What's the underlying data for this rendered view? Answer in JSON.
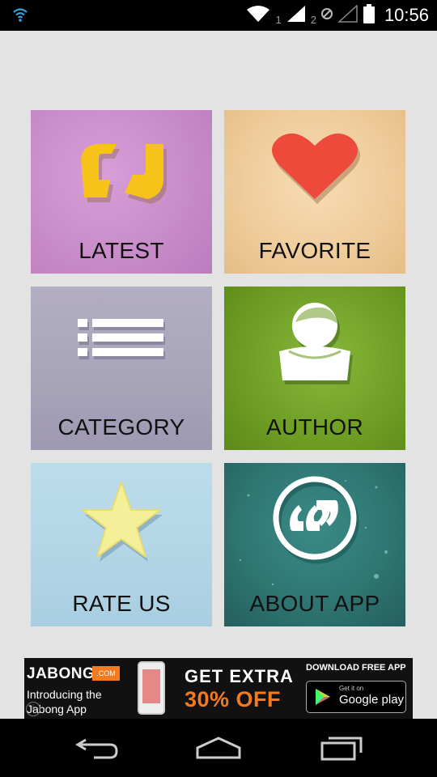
{
  "status_bar": {
    "sim1_label": "1",
    "sim2_label": "2",
    "time": "10:56",
    "icons": [
      "wifi-icon",
      "wifi-signal-icon",
      "cell-signal-1-icon",
      "cell-signal-2-icon",
      "cell-signal-empty-icon",
      "battery-icon"
    ]
  },
  "menu": {
    "latest": {
      "label": "LATEST",
      "icon": "quote-icon"
    },
    "favorite": {
      "label": "FAVORITE",
      "icon": "heart-icon"
    },
    "category": {
      "label": "CATEGORY",
      "icon": "list-icon"
    },
    "author": {
      "label": "AUTHOR",
      "icon": "person-icon"
    },
    "rate_us": {
      "label": "RATE US",
      "icon": "star-icon"
    },
    "about_app": {
      "label": "ABOUT APP",
      "icon": "quote-circle-icon"
    }
  },
  "ad": {
    "brand": "JABONG",
    "brand_tag": ".COM",
    "intro_line1": "Introducing the",
    "intro_line2": "Jabong App",
    "headline": "GET EXTRA",
    "offer": "30% OFF",
    "download_label": "DOWNLOAD FREE APP",
    "store_sub": "Get it on",
    "store_name": "Google play",
    "info_glyph": "i"
  },
  "colors": {
    "latest_bg": "#c98cca",
    "favorite_bg": "#efcd9c",
    "category_bg": "#a7a3b9",
    "author_bg": "#6f9d24",
    "rate_bg": "#b2d5e6",
    "about_bg": "#2f7673",
    "ad_accent": "#f47a20"
  }
}
